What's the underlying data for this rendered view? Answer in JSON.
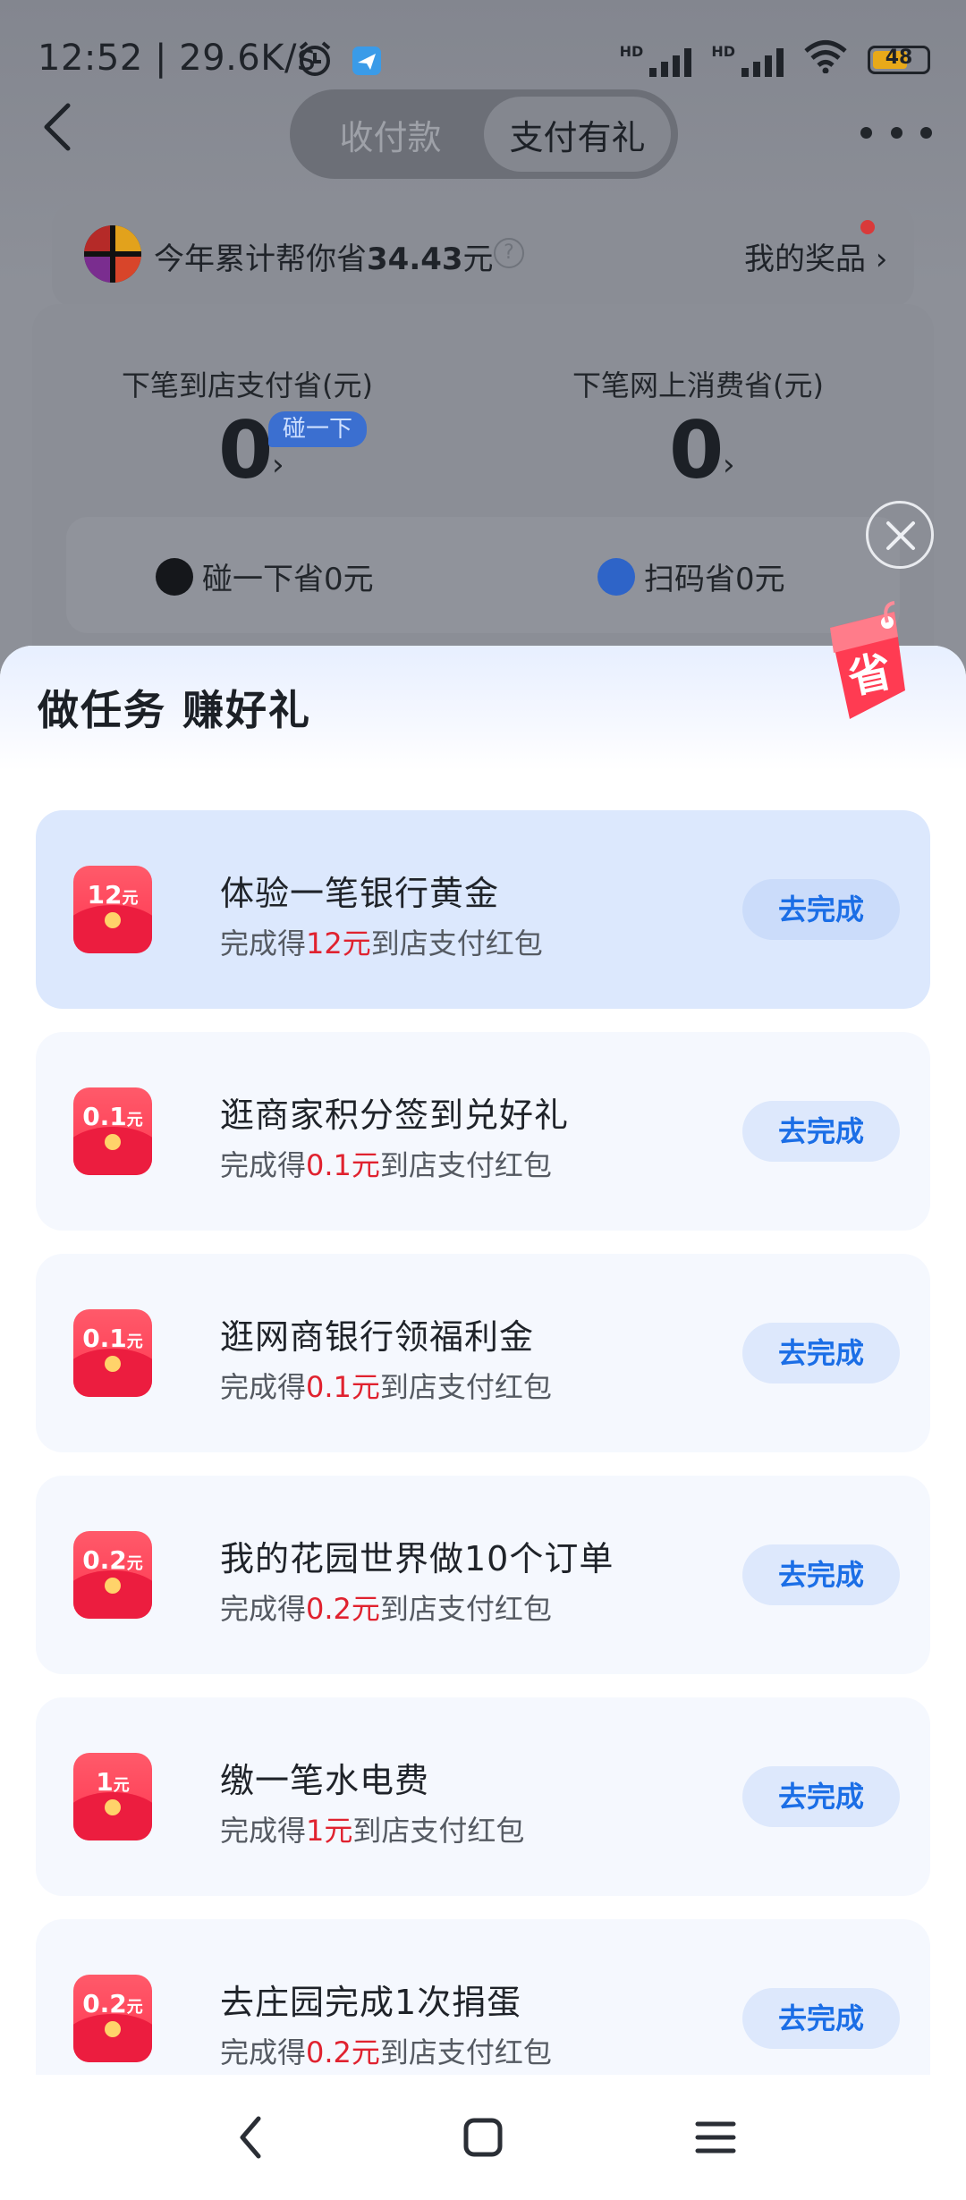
{
  "status": {
    "time": "12:52 | 29.6K/s",
    "battery": "48",
    "hd1": "HD",
    "hd2": "HD"
  },
  "header": {
    "tabs": [
      {
        "label": "收付款",
        "active": false
      },
      {
        "label": "支付有礼",
        "active": true
      }
    ]
  },
  "savings": {
    "prefix": "今年累计帮你省",
    "amount": "34.43",
    "suffix": "元",
    "prizes_label": "我的奖品 ›"
  },
  "stats": {
    "store_label": "下笔到店支付省(元)",
    "store_value": "0",
    "touch_tag": "碰一下",
    "online_label": "下笔网上消费省(元)",
    "online_value": "0",
    "chev": "›",
    "touch_save": "碰一下省0元",
    "scan_save": "扫码省0元"
  },
  "sheet": {
    "title": "做任务 赚好礼",
    "badge_char": "省"
  },
  "tasks": [
    {
      "env_amount": "12",
      "env_unit": "元",
      "title": "体验一笔银行黄金",
      "desc_prefix": "完成得",
      "desc_amount": "12元",
      "desc_suffix": "到店支付红包",
      "button": "去完成",
      "highlight": true
    },
    {
      "env_amount": "0.1",
      "env_unit": "元",
      "title": "逛商家积分签到兑好礼",
      "desc_prefix": "完成得",
      "desc_amount": "0.1元",
      "desc_suffix": "到店支付红包",
      "button": "去完成",
      "highlight": false
    },
    {
      "env_amount": "0.1",
      "env_unit": "元",
      "title": "逛网商银行领福利金",
      "desc_prefix": "完成得",
      "desc_amount": "0.1元",
      "desc_suffix": "到店支付红包",
      "button": "去完成",
      "highlight": false
    },
    {
      "env_amount": "0.2",
      "env_unit": "元",
      "title": "我的花园世界做10个订单",
      "desc_prefix": "完成得",
      "desc_amount": "0.2元",
      "desc_suffix": "到店支付红包",
      "button": "去完成",
      "highlight": false
    },
    {
      "env_amount": "1",
      "env_unit": "元",
      "title": "缴一笔水电费",
      "desc_prefix": "完成得",
      "desc_amount": "1元",
      "desc_suffix": "到店支付红包",
      "button": "去完成",
      "highlight": false
    },
    {
      "env_amount": "0.2",
      "env_unit": "元",
      "title": "去庄园完成1次捐蛋",
      "desc_prefix": "完成得",
      "desc_amount": "0.2元",
      "desc_suffix": "到店支付红包",
      "button": "去完成",
      "highlight": false
    }
  ],
  "colors": {
    "accent_blue": "#1b6ee6",
    "amount_red": "#e0222f",
    "envelope_red": "#ff3550"
  }
}
